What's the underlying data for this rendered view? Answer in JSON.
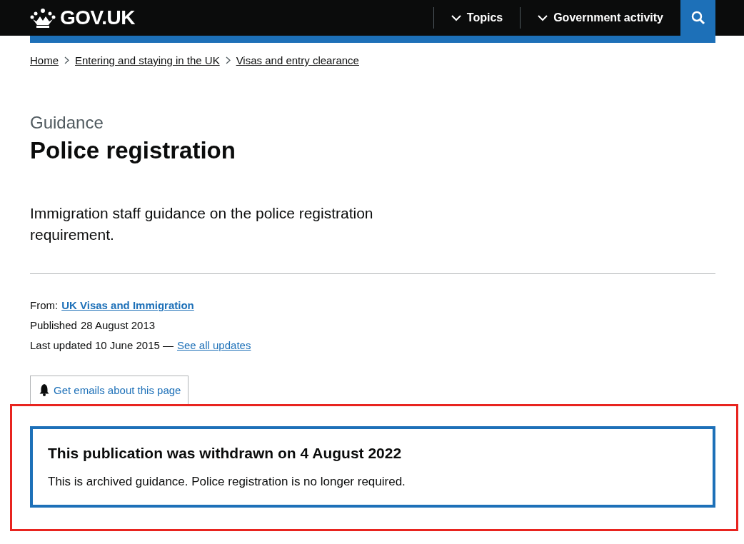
{
  "header": {
    "logo": "GOV.UK",
    "nav": [
      {
        "label": "Topics"
      },
      {
        "label": "Government activity"
      }
    ]
  },
  "breadcrumbs": [
    "Home",
    "Entering and staying in the UK",
    "Visas and entry clearance"
  ],
  "caption": "Guidance",
  "title": "Police registration",
  "lead": "Immigration staff guidance on the police registration requirement.",
  "metadata": {
    "from_label": "From:",
    "from_link": "UK Visas and Immigration",
    "published_label": "Published",
    "published": "28 August 2013",
    "updated": "Last updated 10 June 2015 —",
    "updates_link": "See all updates"
  },
  "email_button": "Get emails about this page",
  "notice": {
    "title": "This publication was withdrawn on 4 August 2022",
    "body": "This is archived guidance. Police registration is no longer required."
  }
}
